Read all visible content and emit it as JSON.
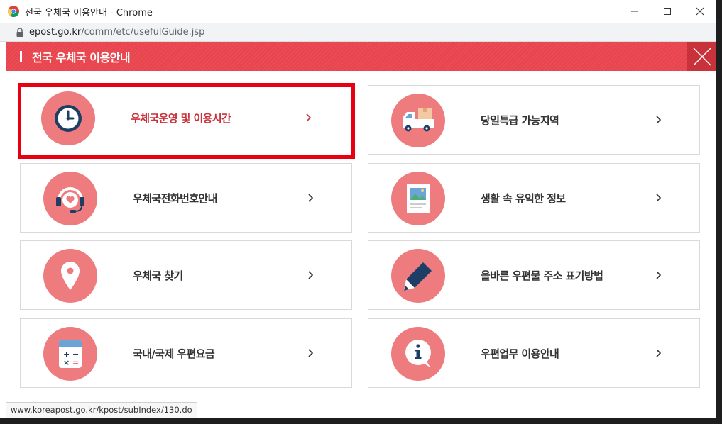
{
  "window": {
    "title": "전국 우체국 이용안내 - Chrome",
    "controls": [
      "minimize",
      "maximize",
      "close"
    ]
  },
  "address_bar": {
    "host": "epost.go.kr",
    "path": "/comm/etc/usefulGuide.jsp",
    "secure_icon": "lock-icon"
  },
  "popup": {
    "title": "전국 우체국 이용안내",
    "close_icon": "close-icon",
    "accent_color": "#e8454e",
    "icon_circle_color": "#ee7b7e",
    "highlight_color": "#e60012"
  },
  "cards": [
    {
      "label": "우체국운영 및 이용시간",
      "icon": "clock-icon",
      "highlighted": true
    },
    {
      "label": "당일특급 가능지역",
      "icon": "delivery-truck-icon",
      "highlighted": false
    },
    {
      "label": "우체국전화번호안내",
      "icon": "headset-icon",
      "highlighted": false
    },
    {
      "label": "생활 속 유익한 정보",
      "icon": "picture-book-icon",
      "highlighted": false
    },
    {
      "label": "우체국 찾기",
      "icon": "map-pin-icon",
      "highlighted": false
    },
    {
      "label": "올바른 우편물 주소 표기방법",
      "icon": "pencil-icon",
      "highlighted": false
    },
    {
      "label": "국내/국제 우편요금",
      "icon": "calculator-icon",
      "highlighted": false
    },
    {
      "label": "우편업무 이용안내",
      "icon": "info-bubble-icon",
      "highlighted": false
    }
  ],
  "status_bar": {
    "text": "www.koreapost.go.kr/kpost/subIndex/130.do"
  }
}
